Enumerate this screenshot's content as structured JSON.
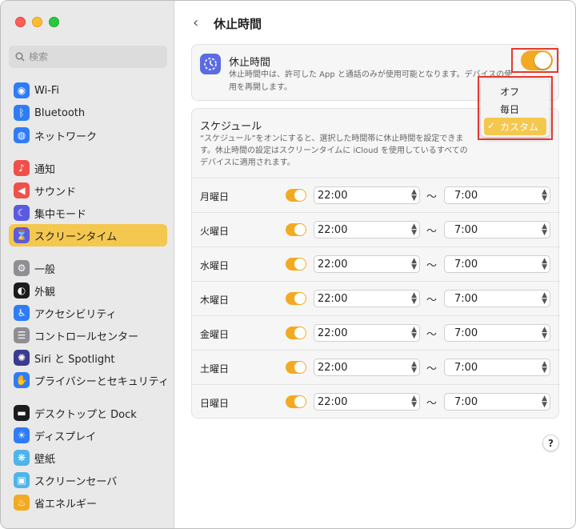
{
  "search": {
    "placeholder": "検索"
  },
  "sidebar": {
    "items": [
      {
        "label": "Wi-Fi",
        "icon": "wifi-icon",
        "color": "#2f7cf6",
        "glyph": "◉"
      },
      {
        "label": "Bluetooth",
        "icon": "bluetooth-icon",
        "color": "#2f7cf6",
        "glyph": "ᛒ"
      },
      {
        "label": "ネットワーク",
        "icon": "globe-icon",
        "color": "#2f7cf6",
        "glyph": "◍"
      },
      {
        "label": "通知",
        "icon": "bell-icon",
        "color": "#f0504a",
        "glyph": "♪"
      },
      {
        "label": "サウンド",
        "icon": "speaker-icon",
        "color": "#f0504a",
        "glyph": "◀"
      },
      {
        "label": "集中モード",
        "icon": "moon-icon",
        "color": "#5b5be0",
        "glyph": "☾"
      },
      {
        "label": "スクリーンタイム",
        "icon": "hourglass-icon",
        "color": "#5b5be0",
        "glyph": "⌛"
      },
      {
        "label": "一般",
        "icon": "gear-icon",
        "color": "#8e8e93",
        "glyph": "⚙"
      },
      {
        "label": "外観",
        "icon": "appearance-icon",
        "color": "#1c1c1e",
        "glyph": "◐"
      },
      {
        "label": "アクセシビリティ",
        "icon": "accessibility-icon",
        "color": "#2f7cf6",
        "glyph": "♿"
      },
      {
        "label": "コントロールセンター",
        "icon": "control-center-icon",
        "color": "#8e8e93",
        "glyph": "☰"
      },
      {
        "label": "Siri と Spotlight",
        "icon": "siri-icon",
        "color": "#3b3b8f",
        "glyph": "✺"
      },
      {
        "label": "プライバシーとセキュリティ",
        "icon": "hand-icon",
        "color": "#2f7cf6",
        "glyph": "✋"
      },
      {
        "label": "デスクトップと Dock",
        "icon": "dock-icon",
        "color": "#1c1c1e",
        "glyph": "▬"
      },
      {
        "label": "ディスプレイ",
        "icon": "sun-icon",
        "color": "#2f7cf6",
        "glyph": "☀"
      },
      {
        "label": "壁紙",
        "icon": "wallpaper-icon",
        "color": "#4fb4e8",
        "glyph": "❋"
      },
      {
        "label": "スクリーンセーバ",
        "icon": "screensaver-icon",
        "color": "#4fb4e8",
        "glyph": "▣"
      },
      {
        "label": "省エネルギー",
        "icon": "bulb-icon",
        "color": "#f3aa22",
        "glyph": "♨"
      }
    ]
  },
  "header": {
    "back": "‹",
    "title": "休止時間"
  },
  "downtime": {
    "title": "休止時間",
    "description": "休止時間中は、許可した App と通話のみが使用可能となります。デバイスの使用を再開します。",
    "enabled": true
  },
  "menu": {
    "options": [
      "オフ",
      "毎日",
      "カスタム"
    ],
    "selected": "カスタム"
  },
  "schedule": {
    "title": "スケジュール",
    "description": "“スケジュール”をオンにすると、選択した時間帯に休止時間を設定できます。休止時間の設定はスクリーンタイムに iCloud を使用しているすべてのデバイスに適用されます。",
    "separator": "〜",
    "days": [
      {
        "day": "月曜日",
        "start": "22:00",
        "end": "7:00"
      },
      {
        "day": "火曜日",
        "start": "22:00",
        "end": "7:00"
      },
      {
        "day": "水曜日",
        "start": "22:00",
        "end": "7:00"
      },
      {
        "day": "木曜日",
        "start": "22:00",
        "end": "7:00"
      },
      {
        "day": "金曜日",
        "start": "22:00",
        "end": "7:00"
      },
      {
        "day": "土曜日",
        "start": "22:00",
        "end": "7:00"
      },
      {
        "day": "日曜日",
        "start": "22:00",
        "end": "7:00"
      }
    ]
  },
  "help": "?",
  "colors": {
    "accent": "#f3aa22",
    "highlight": "#f4c74e",
    "annotation": "#e33a2f"
  }
}
